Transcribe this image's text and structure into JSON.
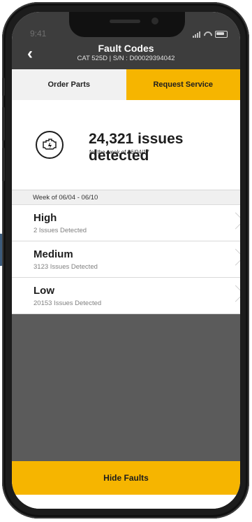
{
  "status_bar": {
    "time": "9:41"
  },
  "header": {
    "back_icon": "chevron-left-icon",
    "title": "Fault Codes",
    "subtitle": "CAT 525D | S/N : D00029394042"
  },
  "tabs": [
    {
      "label": "Order Parts"
    },
    {
      "label": "Request Service"
    }
  ],
  "summary": {
    "icon": "engine-warning-icon",
    "count_text": "24,321 issues detected",
    "week_text": "for the week of 06/04/17"
  },
  "week_header": "Week of 06/04 - 06/10",
  "issues": [
    {
      "label": "High",
      "detail": "2 Issues Detected"
    },
    {
      "label": "Medium",
      "detail": "3123 Issues Detected"
    },
    {
      "label": "Low",
      "detail": "20153 Issues Detected"
    }
  ],
  "footer": {
    "button_label": "Hide Faults"
  },
  "colors": {
    "accent": "#f6b500",
    "header": "#3d3d3d",
    "empty_area": "#5b5b5b"
  }
}
